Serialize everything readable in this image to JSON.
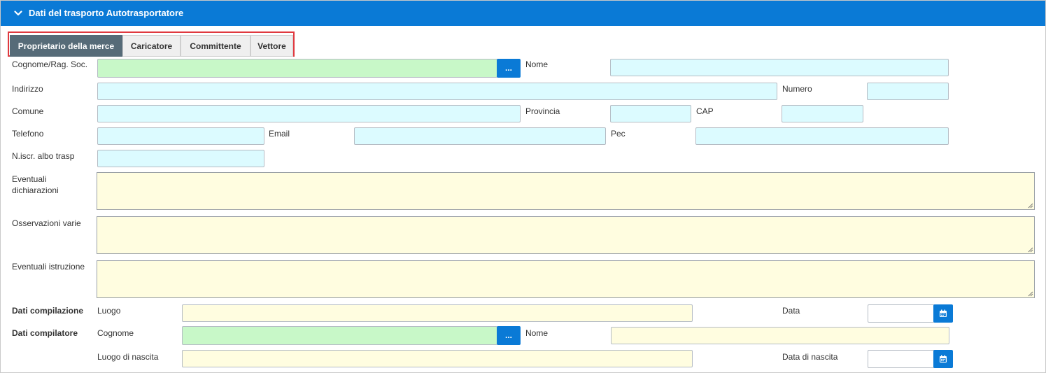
{
  "section": {
    "title": "Dati del trasporto Autotrasportatore",
    "icon": "chevron-down-icon",
    "accent_color": "#0a7ad6"
  },
  "tabs": [
    {
      "label": "Proprietario della merce",
      "active": true
    },
    {
      "label": "Caricatore",
      "active": false
    },
    {
      "label": "Committente",
      "active": false
    },
    {
      "label": "Vettore",
      "active": false
    }
  ],
  "fields": {
    "cognome_rag_soc": {
      "label": "Cognome/Rag. Soc.",
      "value": "",
      "lookup_button_label": "..."
    },
    "nome": {
      "label": "Nome",
      "value": ""
    },
    "indirizzo": {
      "label": "Indirizzo",
      "value": ""
    },
    "numero": {
      "label": "Numero",
      "value": ""
    },
    "comune": {
      "label": "Comune",
      "value": ""
    },
    "provincia": {
      "label": "Provincia",
      "value": ""
    },
    "cap": {
      "label": "CAP",
      "value": ""
    },
    "telefono": {
      "label": "Telefono",
      "value": ""
    },
    "email": {
      "label": "Email",
      "value": ""
    },
    "pec": {
      "label": "Pec",
      "value": ""
    },
    "n_iscr_albo": {
      "label": "N.iscr. albo trasp",
      "value": ""
    },
    "eventuali_dichiarazioni": {
      "label_line1": "Eventuali",
      "label_line2": "dichiarazioni",
      "value": ""
    },
    "osservazioni_varie": {
      "label": "Osservazioni varie",
      "value": ""
    },
    "eventuali_istruzione": {
      "label": "Eventuali istruzione",
      "value": ""
    }
  },
  "dati_compilazione": {
    "section_label": "Dati compilazione",
    "luogo": {
      "label": "Luogo",
      "value": ""
    },
    "data": {
      "label": "Data",
      "value": "",
      "icon": "calendar-icon"
    }
  },
  "dati_compilatore": {
    "section_label": "Dati compilatore",
    "cognome": {
      "label": "Cognome",
      "value": "",
      "lookup_button_label": "..."
    },
    "nome": {
      "label": "Nome",
      "value": ""
    },
    "luogo_nascita": {
      "label": "Luogo di nascita",
      "value": ""
    },
    "data_nascita": {
      "label": "Data di nascita",
      "value": "",
      "icon": "calendar-icon"
    }
  }
}
